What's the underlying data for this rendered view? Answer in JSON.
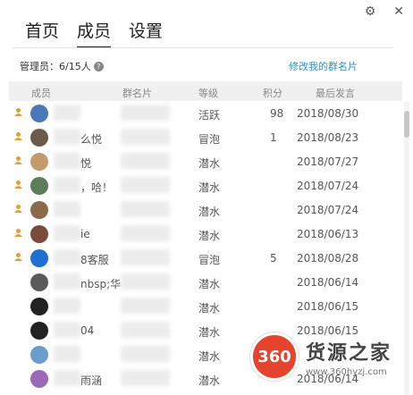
{
  "titlebar": {
    "settings_icon": "⚙",
    "close_icon": "✕"
  },
  "tabs": [
    {
      "label": "首页"
    },
    {
      "label": "成员"
    },
    {
      "label": "设置"
    }
  ],
  "admin": {
    "label": "管理员：6/15人",
    "help": "?"
  },
  "edit_link": "修改我的群名片",
  "columns": {
    "member": "成员",
    "card": "群名片",
    "level": "等级",
    "points": "积分",
    "last": "最后发言"
  },
  "rows": [
    {
      "name": "",
      "level": "活跃",
      "points": "98",
      "date": "2018/08/30",
      "admin": true,
      "avatar_color": "#4a78b8"
    },
    {
      "name": "么悦",
      "level": "冒泡",
      "points": "1",
      "date": "2018/08/23",
      "admin": true,
      "avatar_color": "#6a5a4a"
    },
    {
      "name": "悦",
      "level": "潜水",
      "points": "",
      "date": "2018/07/27",
      "admin": true,
      "avatar_color": "#c49a6c"
    },
    {
      "name": "，哈！",
      "level": "潜水",
      "points": "",
      "date": "2018/07/24",
      "admin": true,
      "avatar_color": "#5b7d5a"
    },
    {
      "name": "",
      "level": "潜水",
      "points": "",
      "date": "2018/07/24",
      "admin": true,
      "avatar_color": "#8a6a4a"
    },
    {
      "name": "ie",
      "level": "潜水",
      "points": "",
      "date": "2018/06/13",
      "admin": true,
      "avatar_color": "#7a4a3a"
    },
    {
      "name": "8客服",
      "level": "冒泡",
      "points": "5",
      "date": "2018/08/28",
      "admin": true,
      "avatar_color": "#1e6fd0"
    },
    {
      "name": "nbsp;华",
      "level": "潜水",
      "points": "",
      "date": "2018/06/14",
      "admin": false,
      "avatar_color": "#5a5a5a"
    },
    {
      "name": "",
      "level": "潜水",
      "points": "",
      "date": "2018/06/15",
      "admin": false,
      "avatar_color": "#222222"
    },
    {
      "name": "04",
      "level": "潜水",
      "points": "",
      "date": "2018/06/15",
      "admin": false,
      "avatar_color": "#222222"
    },
    {
      "name": "",
      "level": "潜水",
      "points": "",
      "date": "",
      "admin": false,
      "avatar_color": "#6a9ccc"
    },
    {
      "name": "雨涵",
      "level": "潜水",
      "points": "",
      "date": "2018/06/14",
      "admin": false,
      "avatar_color": "#9a6ab8"
    }
  ],
  "watermark": {
    "badge": "360",
    "title": "货源之家",
    "url": "www.360hyzj.com"
  }
}
